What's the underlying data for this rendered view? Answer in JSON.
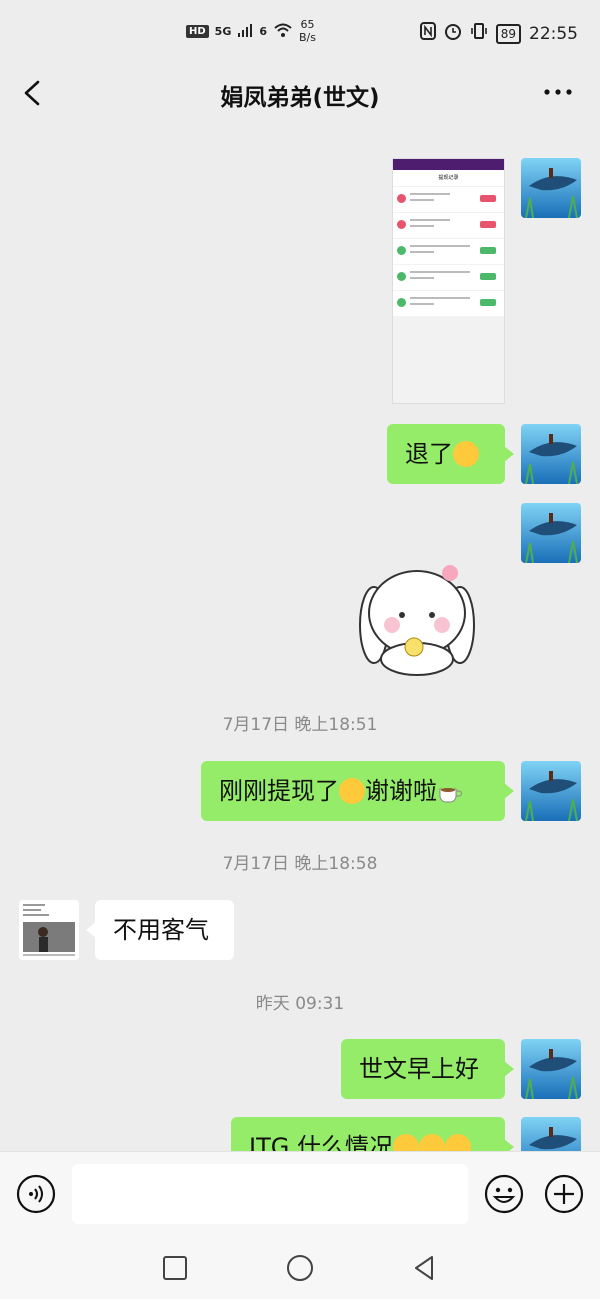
{
  "status_bar": {
    "hd": "HD",
    "network_1": "5G",
    "network_2": "6",
    "speed_value": "65",
    "speed_unit": "B/s",
    "battery": "89",
    "time": "22:55"
  },
  "header": {
    "title": "娟凤弟弟(世文)",
    "more_label": "•••"
  },
  "messages": {
    "m1_text": "退了",
    "m2_text": "刚刚提现了",
    "m2_text_b": "谢谢啦",
    "m3_text": "不用客气",
    "m4_text": "世文早上好",
    "m5_text": "JTG 什么情况"
  },
  "timestamps": {
    "t1": "7月17日 晚上18:51",
    "t2": "7月17日 晚上18:58",
    "t3": "昨天 09:31"
  },
  "screenshot_image": {
    "title": "提现记录"
  },
  "input_bar": {
    "placeholder": ""
  },
  "icons": [
    "back-icon",
    "more-icon",
    "voice-icon",
    "emoji-icon",
    "plus-icon",
    "square-nav-icon",
    "circle-nav-icon",
    "triangle-nav-icon"
  ],
  "colors": {
    "bubble_me": "#95ec69",
    "bubble_other": "#ffffff",
    "background": "#ededed"
  }
}
